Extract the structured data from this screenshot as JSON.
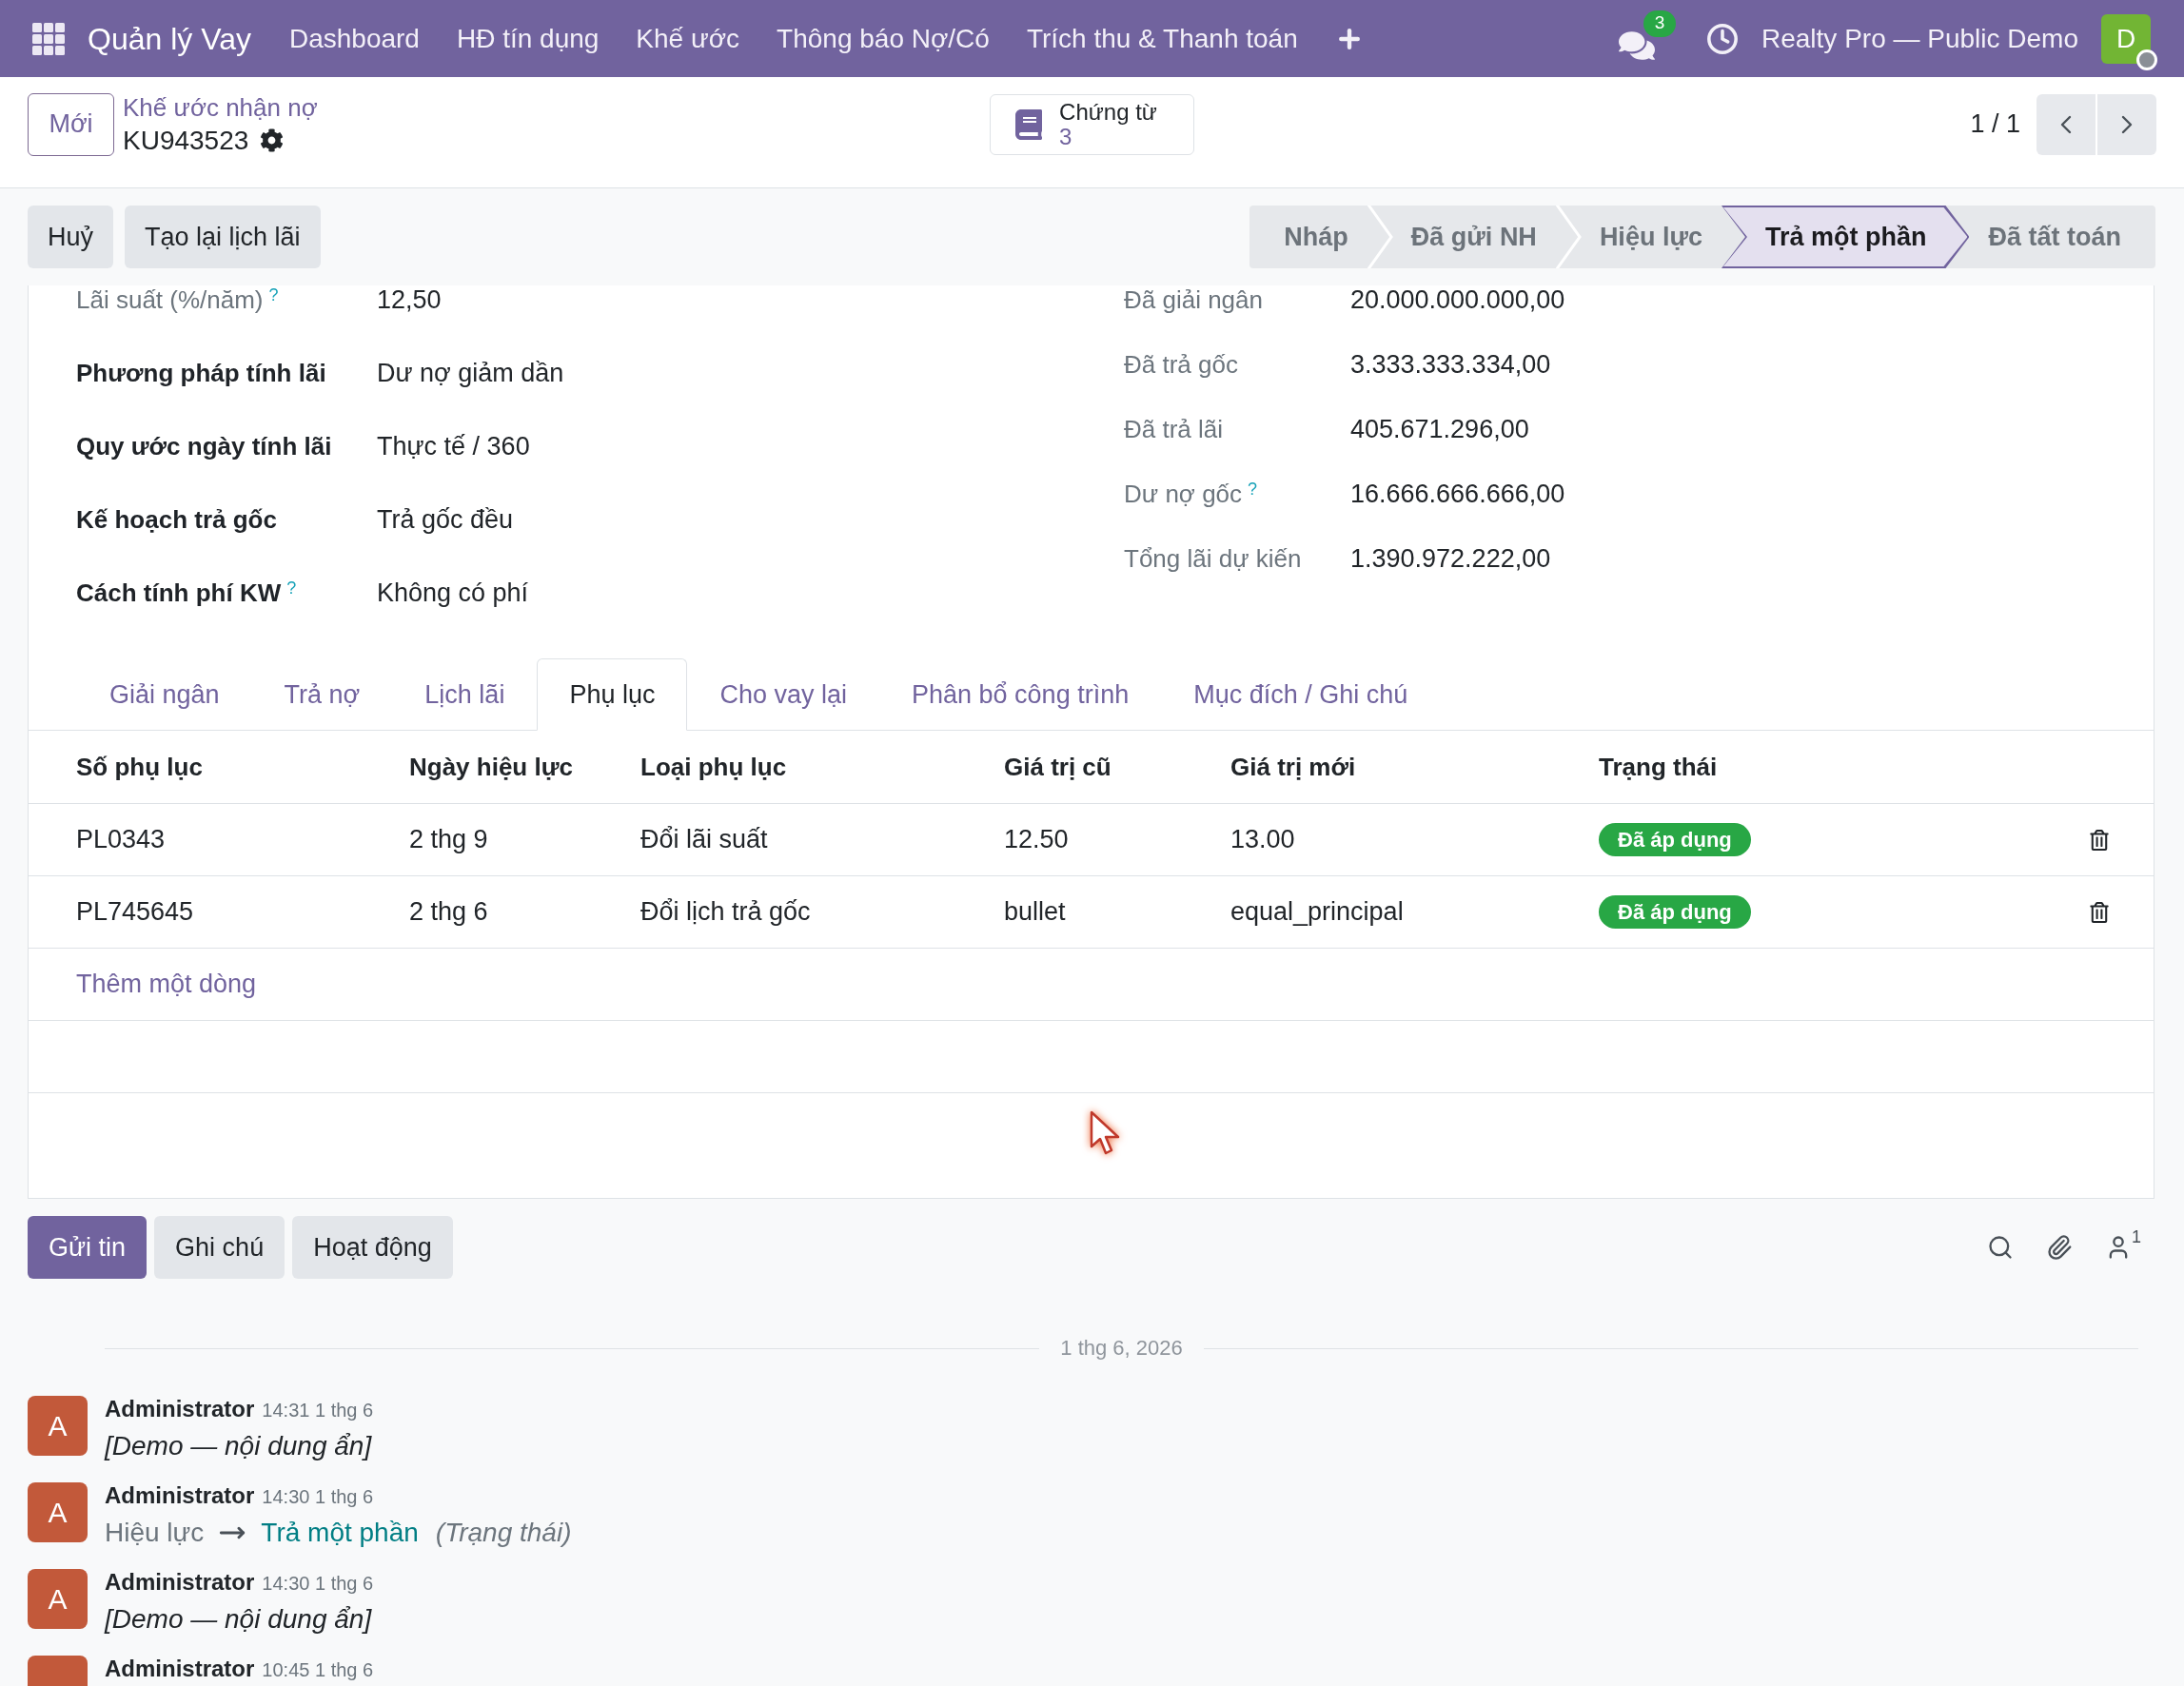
{
  "navbar": {
    "app_name": "Quản lý Vay",
    "menu": [
      "Dashboard",
      "HĐ tín dụng",
      "Khế ước",
      "Thông báo Nợ/Có",
      "Trích thu & Thanh toán"
    ],
    "message_count": "3",
    "company": "Realty Pro — Public Demo",
    "user_initial": "D"
  },
  "control_panel": {
    "new_button": "Mới",
    "breadcrumb": "Khế ước nhận nợ",
    "record_name": "KU943523",
    "smart_button": {
      "label": "Chứng từ",
      "count": "3"
    },
    "pager": "1 / 1"
  },
  "action_buttons": [
    "Huỷ",
    "Tạo lại lịch lãi"
  ],
  "status_steps": [
    {
      "label": "Nháp",
      "selected": false
    },
    {
      "label": "Đã gửi NH",
      "selected": false
    },
    {
      "label": "Hiệu lực",
      "selected": false
    },
    {
      "label": "Trả một phần",
      "selected": true
    },
    {
      "label": "Đã tất toán",
      "selected": false
    }
  ],
  "fields_left": [
    {
      "label": "Lãi suất (%/năm)",
      "help": "?",
      "value": "12,50",
      "muted": true
    },
    {
      "label": "Phương pháp tính lãi",
      "value": "Dư nợ giảm dần",
      "muted": false
    },
    {
      "label": "Quy ước ngày tính lãi",
      "value": "Thực tế / 360",
      "muted": false
    },
    {
      "label": "Kế hoạch trả gốc",
      "value": "Trả gốc đều",
      "muted": false
    },
    {
      "label": "Cách tính phí KW",
      "help": "?",
      "value": "Không có phí",
      "muted": false
    }
  ],
  "fields_right": [
    {
      "label": "Đã giải ngân",
      "value": "20.000.000.000,00",
      "muted": true
    },
    {
      "label": "Đã trả gốc",
      "value": "3.333.333.334,00",
      "muted": true
    },
    {
      "label": "Đã trả lãi",
      "value": "405.671.296,00",
      "muted": true
    },
    {
      "label": "Dư nợ gốc",
      "help": "?",
      "value": "16.666.666.666,00",
      "muted": true
    },
    {
      "label": "Tổng lãi dự kiến",
      "value": "1.390.972.222,00",
      "muted": true
    }
  ],
  "tabs": [
    {
      "label": "Giải ngân",
      "selected": false
    },
    {
      "label": "Trả nợ",
      "selected": false
    },
    {
      "label": "Lịch lãi",
      "selected": false
    },
    {
      "label": "Phụ lục",
      "selected": true
    },
    {
      "label": "Cho vay lại",
      "selected": false
    },
    {
      "label": "Phân bổ công trình",
      "selected": false
    },
    {
      "label": "Mục đích / Ghi chú",
      "selected": false
    }
  ],
  "table": {
    "columns": [
      "Số phụ lục",
      "Ngày hiệu lực",
      "Loại phụ lục",
      "Giá trị cũ",
      "Giá trị mới",
      "Trạng thái"
    ],
    "rows": [
      {
        "cells": [
          "PL0343",
          "2 thg 9",
          "Đổi lãi suất",
          "12.50",
          "13.00"
        ],
        "status": "Đã áp dụng"
      },
      {
        "cells": [
          "PL745645",
          "2 thg 6",
          "Đổi lịch trả gốc",
          "bullet",
          "equal_principal"
        ],
        "status": "Đã áp dụng"
      }
    ],
    "add_line": "Thêm một dòng"
  },
  "chatter": {
    "buttons": [
      {
        "label": "Gửi tin",
        "selected": true
      },
      {
        "label": "Ghi chú",
        "selected": false
      },
      {
        "label": "Hoạt động",
        "selected": false
      }
    ],
    "followers_count": "1",
    "date_separator": "1 thg 6, 2026",
    "messages": [
      {
        "kind": "note",
        "initial": "A",
        "author": "Administrator",
        "time": "14:31 1 thg 6",
        "body": "[Demo — nội dung ẩn]"
      },
      {
        "kind": "tracking",
        "initial": "A",
        "author": "Administrator",
        "time": "14:30 1 thg 6",
        "old_value": "Hiệu lực",
        "new_value": "Trả một phần",
        "field": "(Trạng thái)"
      },
      {
        "kind": "note",
        "initial": "A",
        "author": "Administrator",
        "time": "14:30 1 thg 6",
        "body": "[Demo — nội dung ẩn]"
      },
      {
        "kind": "note",
        "author": "Administrator",
        "time": "10:45 1 thg 6"
      }
    ]
  }
}
